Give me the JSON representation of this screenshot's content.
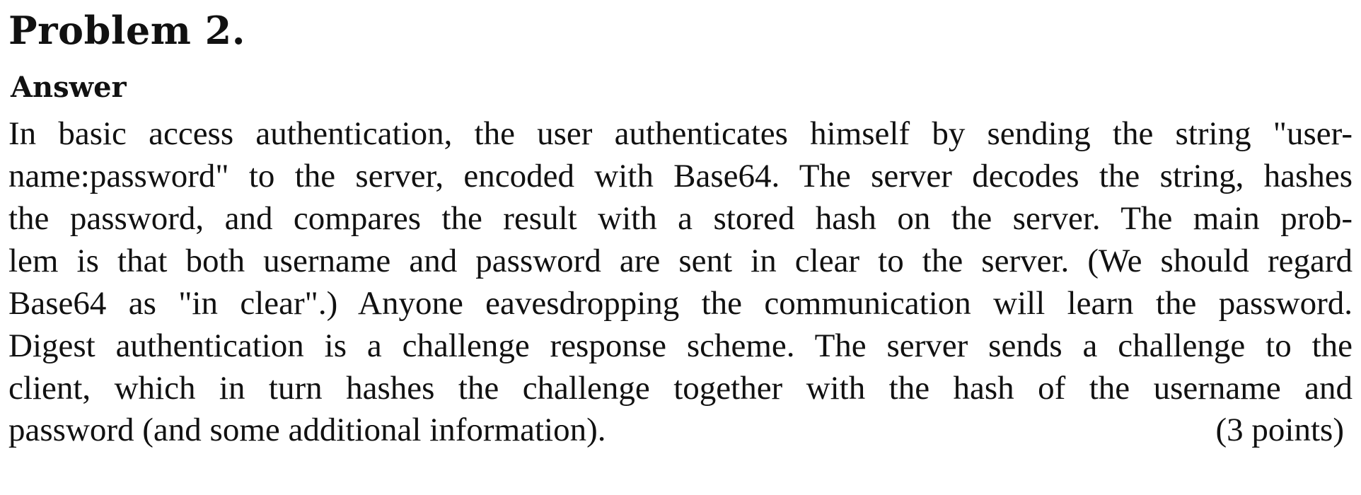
{
  "problem": {
    "title": "Problem 2."
  },
  "answer": {
    "heading": "Answer",
    "lines": [
      "In basic access authentication, the user authenticates himself by sending the string \"user-",
      "name:password\" to the server, encoded with Base64. The server decodes the string, hashes",
      "the password, and compares the result with a stored hash on the server. The main prob-",
      "lem is that both username and password are sent in clear to the server. (We should regard",
      "Base64 as \"in clear\".) Anyone eavesdropping the communication will learn the password.",
      "Digest authentication is a challenge response scheme. The server sends a challenge to the",
      "client, which in turn hashes the challenge together with the hash of the username and",
      "password (and some additional information)."
    ],
    "points": "(3 points)"
  }
}
